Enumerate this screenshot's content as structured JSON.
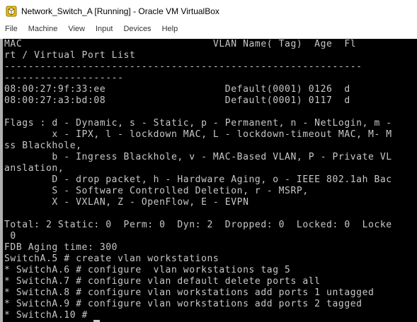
{
  "window": {
    "title": "Network_Switch_A [Running] - Oracle VM VirtualBox",
    "icon": "virtualbox-icon"
  },
  "menu": {
    "items": [
      "File",
      "Machine",
      "View",
      "Input",
      "Devices",
      "Help"
    ]
  },
  "console": {
    "lines": [
      "MAC                                VLAN Name( Tag)  Age  Fl",
      "rt / Virtual Port List",
      "------------------------------------------------------------",
      "--------------------",
      "08:00:27:9f:33:ee                    Default(0001) 0126  d",
      "08:00:27:a3:bd:08                    Default(0001) 0117  d",
      "",
      "Flags : d - Dynamic, s - Static, p - Permanent, n - NetLogin, m -",
      "        x - IPX, l - lockdown MAC, L - lockdown-timeout MAC, M- M",
      "ss Blackhole,",
      "        b - Ingress Blackhole, v - MAC-Based VLAN, P - Private VL",
      "anslation,",
      "        D - drop packet, h - Hardware Aging, o - IEEE 802.1ah Bac",
      "        S - Software Controlled Deletion, r - MSRP,",
      "        X - VXLAN, Z - OpenFlow, E - EVPN",
      "",
      "Total: 2 Static: 0  Perm: 0  Dyn: 2  Dropped: 0  Locked: 0  Locke",
      " 0",
      "FDB Aging time: 300",
      "SwitchA.5 # create vlan workstations",
      "* SwitchA.6 # configure  vlan workstations tag 5",
      "* SwitchA.7 # configure vlan default delete ports all",
      "* SwitchA.8 # configure vlan workstations add ports 1 untagged",
      "* SwitchA.9 # configure vlan workstations add ports 2 tagged",
      "* SwitchA.10 #"
    ]
  }
}
